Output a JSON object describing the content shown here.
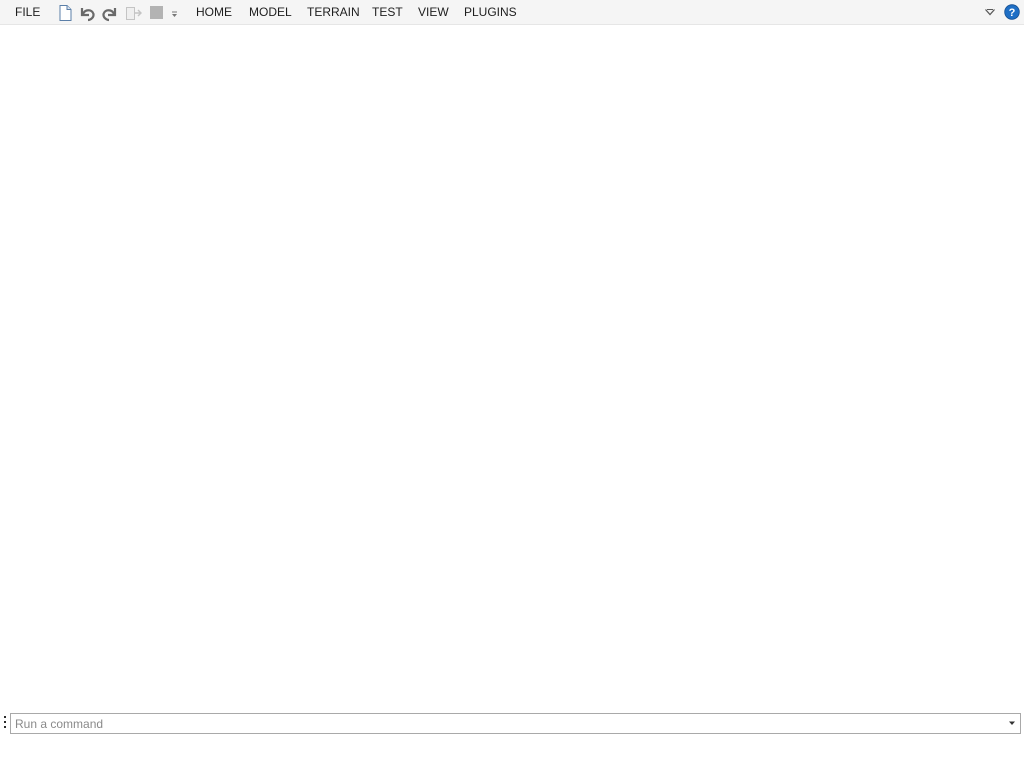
{
  "menu": {
    "file": "FILE",
    "tabs": [
      "HOME",
      "MODEL",
      "TERRAIN",
      "TEST",
      "VIEW",
      "PLUGINS"
    ]
  },
  "quick_access": {
    "icons": [
      "new-document-icon",
      "undo-icon",
      "redo-icon",
      "publish-icon",
      "stop-icon",
      "customize-dropdown-icon"
    ]
  },
  "right_controls": {
    "icons": [
      "collapse-ribbon-icon",
      "help-icon"
    ]
  },
  "command_bar": {
    "placeholder": "Run a command",
    "value": ""
  },
  "colors": {
    "ribbon_background": "#f5f5f5",
    "workspace_background": "#ffffff",
    "help_icon_blue": "#1f6fc5",
    "input_border": "#a9a9a9"
  }
}
